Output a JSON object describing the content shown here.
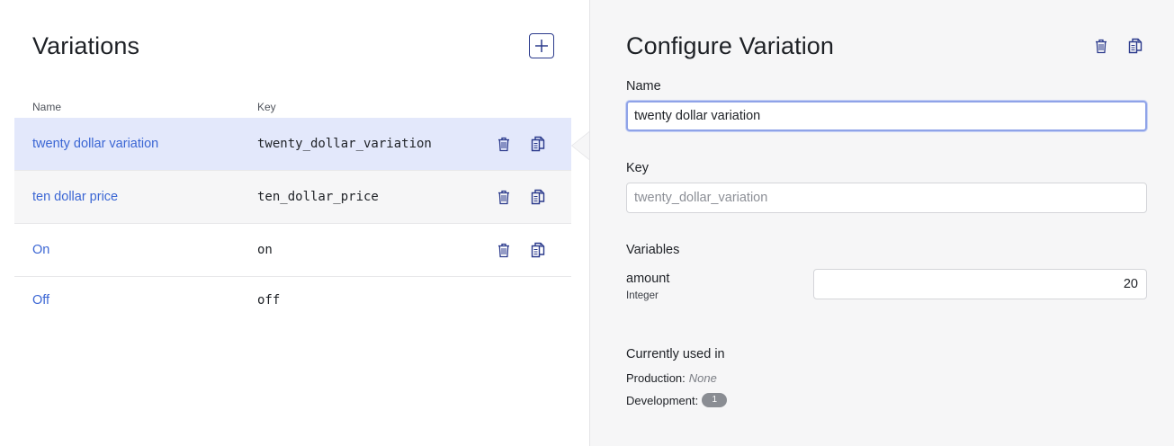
{
  "left": {
    "title": "Variations",
    "columns": {
      "name": "Name",
      "key": "Key"
    },
    "rows": [
      {
        "name": "twenty dollar variation",
        "key": "twenty_dollar_variation",
        "state": "selected"
      },
      {
        "name": "ten dollar price",
        "key": "ten_dollar_price",
        "state": "hover"
      },
      {
        "name": "On",
        "key": "on",
        "state": "normal"
      },
      {
        "name": "Off",
        "key": "off",
        "state": "normal"
      }
    ]
  },
  "right": {
    "title": "Configure Variation",
    "name_label": "Name",
    "name_value": "twenty dollar variation",
    "key_label": "Key",
    "key_placeholder": "twenty_dollar_variation",
    "variables_label": "Variables",
    "variable": {
      "name": "amount",
      "type": "Integer",
      "value": "20"
    },
    "usage": {
      "title": "Currently used in",
      "production_label": "Production:",
      "production_value": "None",
      "development_label": "Development:",
      "development_count": "1"
    }
  },
  "icons": {
    "add": "plus-icon",
    "delete": "trash-icon",
    "duplicate": "copy-icon"
  },
  "colors": {
    "accent": "#2b3a8c",
    "link": "#3b66d4",
    "selected_row": "#e3e8fb",
    "panel_bg": "#f6f6f7"
  }
}
